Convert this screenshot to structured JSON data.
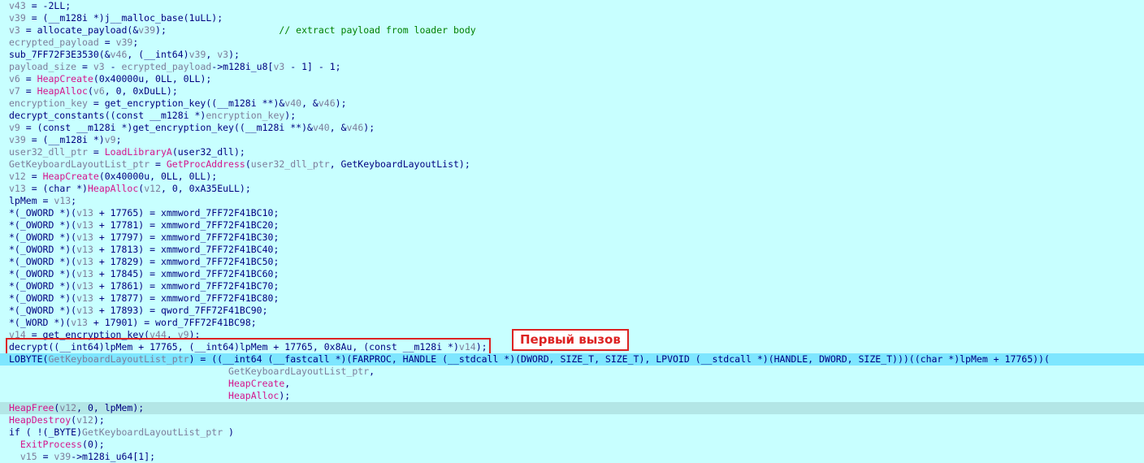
{
  "annotation": {
    "callout_label": "Первый вызов"
  },
  "colors": {
    "background": "#c8ffff",
    "current_line": "#7ee6ff",
    "selected_line": "#b3e6e6",
    "annotation_red": "#dd2222",
    "comment_green": "#008000",
    "import_magenta": "#d4148c",
    "variable_grey": "#7d7d9b",
    "plain_navy": "#000080"
  },
  "lines": [
    {
      "hl": "",
      "tokens": [
        [
          "v",
          "v43"
        ],
        [
          "p",
          " = -2LL;"
        ]
      ]
    },
    {
      "hl": "",
      "tokens": [
        [
          "v",
          "v39"
        ],
        [
          "p",
          " = ("
        ],
        [
          "k",
          "__m128i *"
        ],
        [
          "p",
          ")j__malloc_base(1uLL);"
        ]
      ]
    },
    {
      "hl": "",
      "tokens": [
        [
          "v",
          "v3"
        ],
        [
          "p",
          " = allocate_payload(&"
        ],
        [
          "v",
          "v39"
        ],
        [
          "p",
          ");                    "
        ],
        [
          "c",
          "// extract payload from loader body"
        ]
      ]
    },
    {
      "hl": "",
      "tokens": [
        [
          "g",
          "ecrypted_payload"
        ],
        [
          "p",
          " = "
        ],
        [
          "v",
          "v39"
        ],
        [
          "p",
          ";"
        ]
      ]
    },
    {
      "hl": "",
      "tokens": [
        [
          "p",
          "sub_7FF72F3E3530(&"
        ],
        [
          "v",
          "v46"
        ],
        [
          "p",
          ", ("
        ],
        [
          "k",
          "__int64"
        ],
        [
          "p",
          ")"
        ],
        [
          "v",
          "v39"
        ],
        [
          "p",
          ", "
        ],
        [
          "v",
          "v3"
        ],
        [
          "p",
          ");"
        ]
      ]
    },
    {
      "hl": "",
      "tokens": [
        [
          "g",
          "payload_size"
        ],
        [
          "p",
          " = "
        ],
        [
          "v",
          "v3"
        ],
        [
          "p",
          " - "
        ],
        [
          "g",
          "ecrypted_payload"
        ],
        [
          "p",
          "->m128i_u8["
        ],
        [
          "v",
          "v3"
        ],
        [
          "p",
          " - 1] - 1;"
        ]
      ]
    },
    {
      "hl": "",
      "tokens": [
        [
          "v",
          "v6"
        ],
        [
          "p",
          " = "
        ],
        [
          "i",
          "HeapCreate"
        ],
        [
          "p",
          "(0x40000u, 0LL, 0LL);"
        ]
      ]
    },
    {
      "hl": "",
      "tokens": [
        [
          "v",
          "v7"
        ],
        [
          "p",
          " = "
        ],
        [
          "i",
          "HeapAlloc"
        ],
        [
          "p",
          "("
        ],
        [
          "v",
          "v6"
        ],
        [
          "p",
          ", 0, 0xDuLL);"
        ]
      ]
    },
    {
      "hl": "",
      "tokens": [
        [
          "g",
          "encryption_key"
        ],
        [
          "p",
          " = get_encryption_key(("
        ],
        [
          "k",
          "__m128i **"
        ],
        [
          "p",
          ")&"
        ],
        [
          "v",
          "v40"
        ],
        [
          "p",
          ", &"
        ],
        [
          "v",
          "v46"
        ],
        [
          "p",
          ");"
        ]
      ]
    },
    {
      "hl": "",
      "tokens": [
        [
          "p",
          "decrypt_constants(("
        ],
        [
          "k",
          "const __m128i *"
        ],
        [
          "p",
          ")"
        ],
        [
          "g",
          "encryption_key"
        ],
        [
          "p",
          ");"
        ]
      ]
    },
    {
      "hl": "",
      "tokens": [
        [
          "v",
          "v9"
        ],
        [
          "p",
          " = ("
        ],
        [
          "k",
          "const __m128i *"
        ],
        [
          "p",
          ")get_encryption_key(("
        ],
        [
          "k",
          "__m128i **"
        ],
        [
          "p",
          ")&"
        ],
        [
          "v",
          "v40"
        ],
        [
          "p",
          ", &"
        ],
        [
          "v",
          "v46"
        ],
        [
          "p",
          ");"
        ]
      ]
    },
    {
      "hl": "",
      "tokens": [
        [
          "v",
          "v39"
        ],
        [
          "p",
          " = ("
        ],
        [
          "k",
          "__m128i *"
        ],
        [
          "p",
          ")"
        ],
        [
          "v",
          "v9"
        ],
        [
          "p",
          ";"
        ]
      ]
    },
    {
      "hl": "",
      "tokens": [
        [
          "g",
          "user32_dll_ptr"
        ],
        [
          "p",
          " = "
        ],
        [
          "i",
          "LoadLibraryA"
        ],
        [
          "p",
          "(user32_dll);"
        ]
      ]
    },
    {
      "hl": "",
      "tokens": [
        [
          "g",
          "GetKeyboardLayoutList_ptr"
        ],
        [
          "p",
          " = "
        ],
        [
          "i",
          "GetProcAddress"
        ],
        [
          "p",
          "("
        ],
        [
          "g",
          "user32_dll_ptr"
        ],
        [
          "p",
          ", GetKeyboardLayoutList);"
        ]
      ]
    },
    {
      "hl": "",
      "tokens": [
        [
          "v",
          "v12"
        ],
        [
          "p",
          " = "
        ],
        [
          "i",
          "HeapCreate"
        ],
        [
          "p",
          "(0x40000u, 0LL, 0LL);"
        ]
      ]
    },
    {
      "hl": "",
      "tokens": [
        [
          "v",
          "v13"
        ],
        [
          "p",
          " = ("
        ],
        [
          "k",
          "char *"
        ],
        [
          "p",
          ")"
        ],
        [
          "i",
          "HeapAlloc"
        ],
        [
          "p",
          "("
        ],
        [
          "v",
          "v12"
        ],
        [
          "p",
          ", 0, 0xA35EuLL);"
        ]
      ]
    },
    {
      "hl": "",
      "tokens": [
        [
          "p",
          "lpMem = "
        ],
        [
          "v",
          "v13"
        ],
        [
          "p",
          ";"
        ]
      ]
    },
    {
      "hl": "",
      "tokens": [
        [
          "p",
          "*("
        ],
        [
          "k",
          "_OWORD *"
        ],
        [
          "p",
          ")("
        ],
        [
          "v",
          "v13"
        ],
        [
          "p",
          " + 17765) = xmmword_7FF72F41BC10;"
        ]
      ]
    },
    {
      "hl": "",
      "tokens": [
        [
          "p",
          "*("
        ],
        [
          "k",
          "_OWORD *"
        ],
        [
          "p",
          ")("
        ],
        [
          "v",
          "v13"
        ],
        [
          "p",
          " + 17781) = xmmword_7FF72F41BC20;"
        ]
      ]
    },
    {
      "hl": "",
      "tokens": [
        [
          "p",
          "*("
        ],
        [
          "k",
          "_OWORD *"
        ],
        [
          "p",
          ")("
        ],
        [
          "v",
          "v13"
        ],
        [
          "p",
          " + 17797) = xmmword_7FF72F41BC30;"
        ]
      ]
    },
    {
      "hl": "",
      "tokens": [
        [
          "p",
          "*("
        ],
        [
          "k",
          "_OWORD *"
        ],
        [
          "p",
          ")("
        ],
        [
          "v",
          "v13"
        ],
        [
          "p",
          " + 17813) = xmmword_7FF72F41BC40;"
        ]
      ]
    },
    {
      "hl": "",
      "tokens": [
        [
          "p",
          "*("
        ],
        [
          "k",
          "_OWORD *"
        ],
        [
          "p",
          ")("
        ],
        [
          "v",
          "v13"
        ],
        [
          "p",
          " + 17829) = xmmword_7FF72F41BC50;"
        ]
      ]
    },
    {
      "hl": "",
      "tokens": [
        [
          "p",
          "*("
        ],
        [
          "k",
          "_OWORD *"
        ],
        [
          "p",
          ")("
        ],
        [
          "v",
          "v13"
        ],
        [
          "p",
          " + 17845) = xmmword_7FF72F41BC60;"
        ]
      ]
    },
    {
      "hl": "",
      "tokens": [
        [
          "p",
          "*("
        ],
        [
          "k",
          "_OWORD *"
        ],
        [
          "p",
          ")("
        ],
        [
          "v",
          "v13"
        ],
        [
          "p",
          " + 17861) = xmmword_7FF72F41BC70;"
        ]
      ]
    },
    {
      "hl": "",
      "tokens": [
        [
          "p",
          "*("
        ],
        [
          "k",
          "_OWORD *"
        ],
        [
          "p",
          ")("
        ],
        [
          "v",
          "v13"
        ],
        [
          "p",
          " + 17877) = xmmword_7FF72F41BC80;"
        ]
      ]
    },
    {
      "hl": "",
      "tokens": [
        [
          "p",
          "*("
        ],
        [
          "k",
          "_QWORD *"
        ],
        [
          "p",
          ")("
        ],
        [
          "v",
          "v13"
        ],
        [
          "p",
          " + 17893) = qword_7FF72F41BC90;"
        ]
      ]
    },
    {
      "hl": "",
      "tokens": [
        [
          "p",
          "*("
        ],
        [
          "k",
          "_WORD *"
        ],
        [
          "p",
          ")("
        ],
        [
          "v",
          "v13"
        ],
        [
          "p",
          " + 17901) = word_7FF72F41BC98;"
        ]
      ]
    },
    {
      "hl": "",
      "tokens": [
        [
          "v",
          "v14"
        ],
        [
          "p",
          " = get_encryption_key("
        ],
        [
          "v",
          "v44"
        ],
        [
          "p",
          ", "
        ],
        [
          "v",
          "v9"
        ],
        [
          "p",
          ");"
        ]
      ]
    },
    {
      "hl": "",
      "boxed": true,
      "tokens": [
        [
          "p",
          "decrypt(("
        ],
        [
          "k",
          "__int64"
        ],
        [
          "p",
          ")lpMem + 17765, ("
        ],
        [
          "k",
          "__int64"
        ],
        [
          "p",
          ")lpMem + 17765, 0x8Au, ("
        ],
        [
          "k",
          "const __m128i *"
        ],
        [
          "p",
          ")"
        ],
        [
          "v",
          "v14"
        ],
        [
          "p",
          ");"
        ]
      ]
    },
    {
      "hl": "cur",
      "tokens": [
        [
          "p",
          "LOBYTE("
        ],
        [
          "g",
          "GetKeyboardLayoutList_ptr"
        ],
        [
          "p",
          ") = (("
        ],
        [
          "k",
          "__int64 (__fastcall *)(FARPROC, HANDLE (__stdcall *)(DWORD, SIZE_T, SIZE_T), LPVOID (__stdcall *)(HANDLE, DWORD, SIZE_T))"
        ],
        [
          "p",
          ")(("
        ],
        [
          "k",
          "char *"
        ],
        [
          "p",
          ")lpMem + 17765))("
        ]
      ]
    },
    {
      "hl": "",
      "tokens": [
        [
          "p",
          "                                       "
        ],
        [
          "g",
          "GetKeyboardLayoutList_ptr"
        ],
        [
          "p",
          ","
        ]
      ]
    },
    {
      "hl": "",
      "tokens": [
        [
          "p",
          "                                       "
        ],
        [
          "i",
          "HeapCreate"
        ],
        [
          "p",
          ","
        ]
      ]
    },
    {
      "hl": "",
      "tokens": [
        [
          "p",
          "                                       "
        ],
        [
          "i",
          "HeapAlloc"
        ],
        [
          "p",
          ");"
        ]
      ]
    },
    {
      "hl": "sel",
      "tokens": [
        [
          "i",
          "HeapFree"
        ],
        [
          "p",
          "("
        ],
        [
          "v",
          "v12"
        ],
        [
          "p",
          ", 0, lpMem);"
        ]
      ]
    },
    {
      "hl": "",
      "tokens": [
        [
          "i",
          "HeapDestroy"
        ],
        [
          "p",
          "("
        ],
        [
          "v",
          "v12"
        ],
        [
          "p",
          ");"
        ]
      ]
    },
    {
      "hl": "",
      "tokens": [
        [
          "p",
          "if ( !("
        ],
        [
          "k",
          "_BYTE"
        ],
        [
          "p",
          ")"
        ],
        [
          "g",
          "GetKeyboardLayoutList_ptr"
        ],
        [
          "p",
          " )"
        ]
      ]
    },
    {
      "hl": "",
      "tokens": [
        [
          "p",
          "  "
        ],
        [
          "i",
          "ExitProcess"
        ],
        [
          "p",
          "(0);"
        ]
      ]
    },
    {
      "hl": "",
      "tokens": [
        [
          "p",
          "  "
        ],
        [
          "v",
          "v15"
        ],
        [
          "p",
          " = "
        ],
        [
          "g",
          "v39"
        ],
        [
          "p",
          "->m128i_u64[1];"
        ]
      ]
    }
  ]
}
